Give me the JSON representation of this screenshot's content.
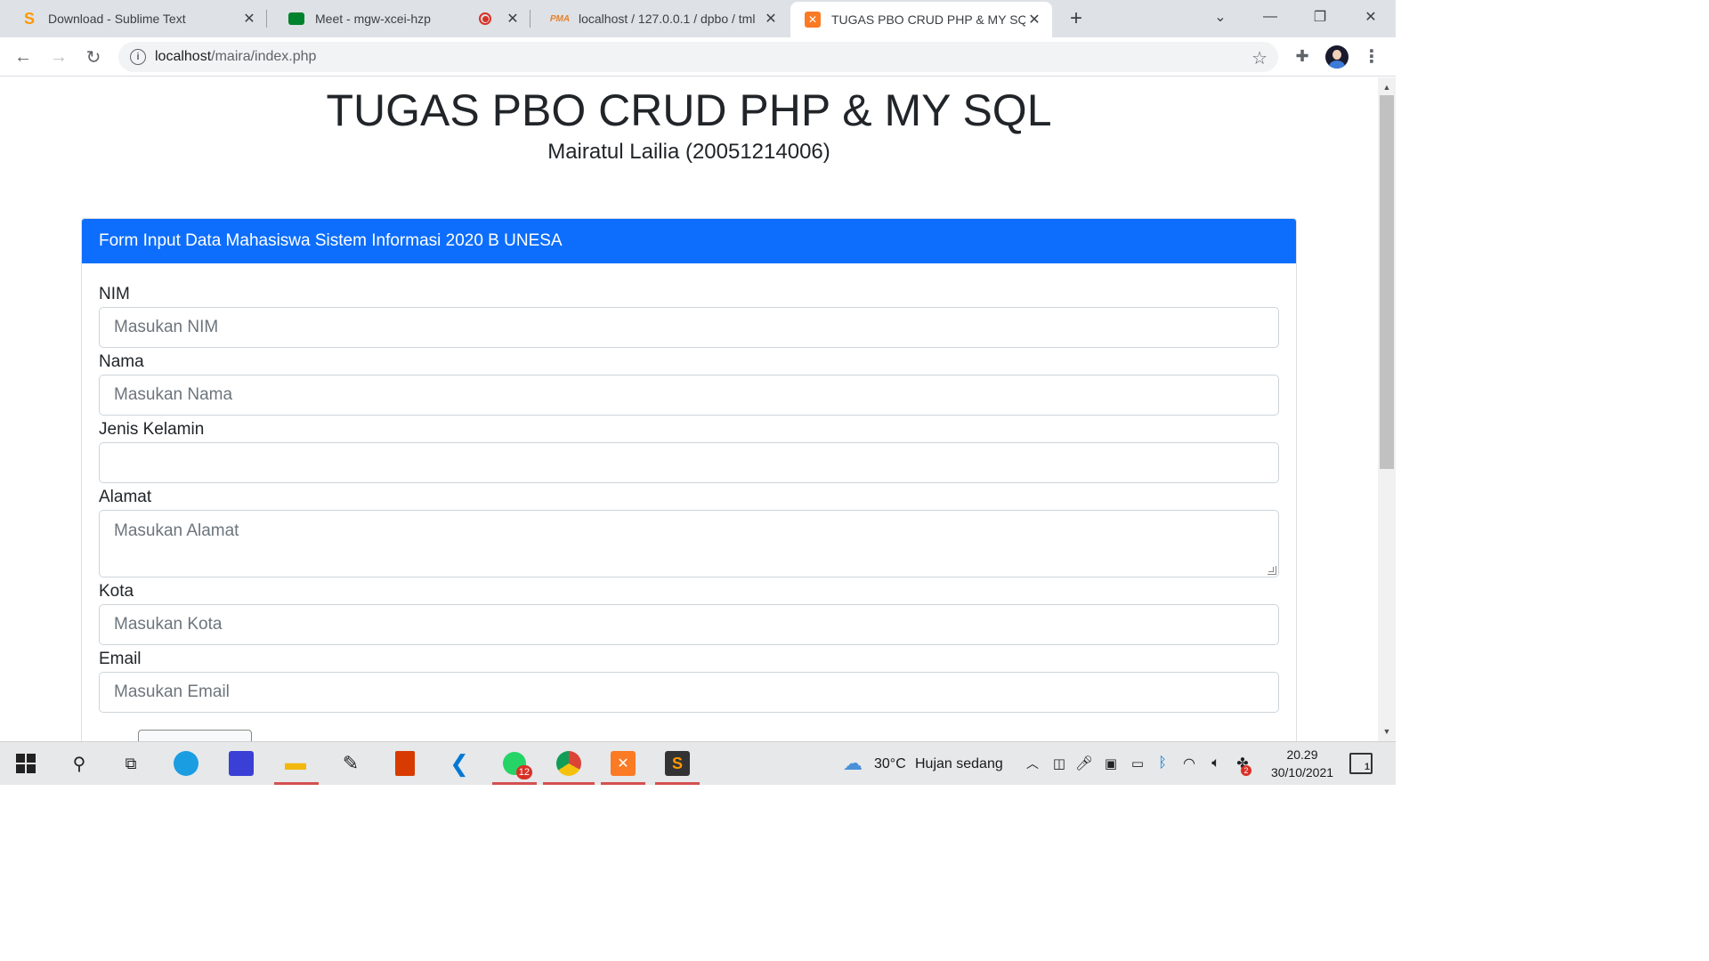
{
  "browser": {
    "tabs": [
      {
        "title": "Download - Sublime Text",
        "icon": "sublime-icon",
        "active": false
      },
      {
        "title": "Meet - mgw-xcei-hzp",
        "icon": "google-meet-icon",
        "active": false,
        "recording": true
      },
      {
        "title": "localhost / 127.0.0.1 / dpbo / tml",
        "icon": "phpmyadmin-icon",
        "active": false
      },
      {
        "title": "TUGAS PBO CRUD PHP & MY SQ",
        "icon": "xampp-icon",
        "active": true
      }
    ],
    "url_host": "localhost",
    "url_path": "/maira/index.php"
  },
  "page": {
    "title": "TUGAS PBO CRUD PHP & MY SQL",
    "subtitle": "Mairatul Lailia (20051214006)",
    "card_header": "Form Input Data Mahasiswa Sistem Informasi 2020 B UNESA",
    "fields": [
      {
        "label": "NIM",
        "placeholder": "Masukan NIM",
        "type": "input"
      },
      {
        "label": "Nama",
        "placeholder": "Masukan Nama",
        "type": "input"
      },
      {
        "label": "Jenis Kelamin",
        "placeholder": "",
        "type": "select"
      },
      {
        "label": "Alamat",
        "placeholder": "Masukan Alamat",
        "type": "textarea"
      },
      {
        "label": "Kota",
        "placeholder": "Masukan Kota",
        "type": "input"
      },
      {
        "label": "Email",
        "placeholder": "Masukan Email",
        "type": "input"
      }
    ]
  },
  "taskbar": {
    "weather_temp": "30°C",
    "weather_desc": "Hujan sedang",
    "time": "20.29",
    "date": "30/10/2021",
    "whatsapp_badge": "12",
    "notification_count": "1",
    "tray_badge": "2"
  },
  "colors": {
    "primary": "#0d6efd",
    "tabstrip": "#dee1e6",
    "taskbar": "#e6e8ea"
  }
}
